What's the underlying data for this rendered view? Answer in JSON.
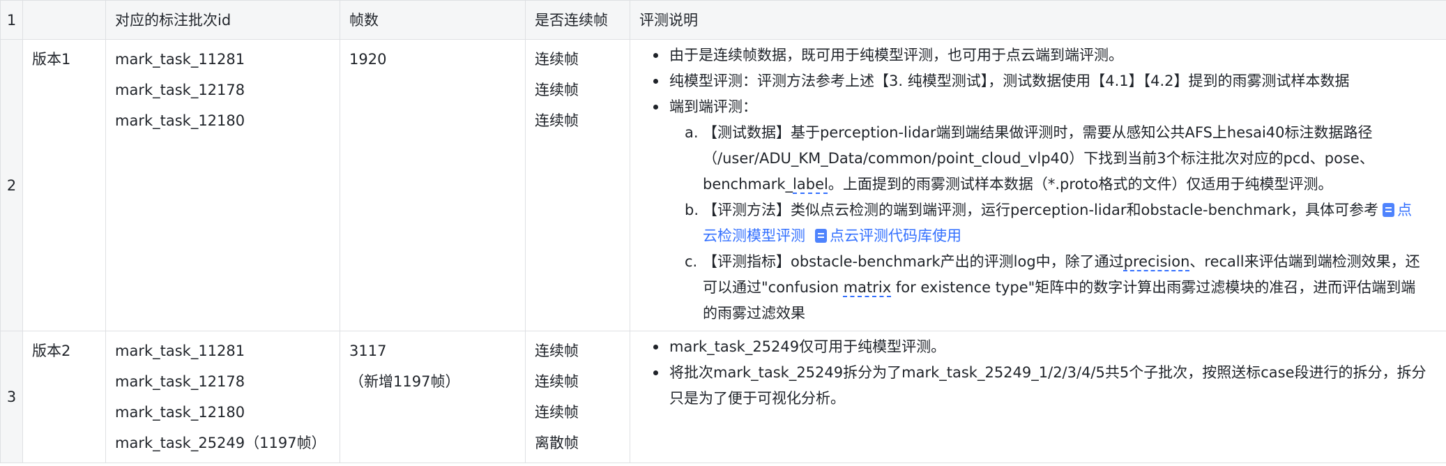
{
  "header": {
    "row_number": "1",
    "col_id": "对应的标注批次id",
    "col_frames": "帧数",
    "col_continuous": "是否连续帧",
    "col_desc": "评测说明"
  },
  "rows": [
    {
      "row_number": "2",
      "version": "版本1",
      "ids": [
        "mark_task_11281",
        "mark_task_12178",
        "mark_task_12180"
      ],
      "frames": [
        "1920"
      ],
      "continuous": [
        "连续帧",
        "连续帧",
        "连续帧"
      ],
      "desc": {
        "bullet1": "由于是连续帧数据，既可用于纯模型评测，也可用于点云端到端评测。",
        "bullet2": "纯模型评测：评测方法参考上述【3. 纯模型测试】，测试数据使用【4.1】【4.2】提到的雨雾测试样本数据",
        "bullet3": "端到端评测：",
        "sub_a": {
          "mark": "a.",
          "line1": "【测试数据】基于perception-lidar端到端结果做评测时，需要从感知公共AFS上hesai40标注数据路径",
          "line2": "（/user/ADU_KM_Data/common/point_cloud_vlp40）下找到当前3个标注批次对应的pcd、pose、",
          "line3_pre": "benchmark_",
          "line3_mid": "label",
          "line3_post": "。上面提到的雨雾测试样本数据（*.proto格式的文件）仅适用于纯模型评测。"
        },
        "sub_b": {
          "mark": "b.",
          "line1": "【评测方法】类似点云检测的端到端评测，运行perception-lidar和obstacle-benchmark，具体可参考",
          "link1_a": "点",
          "link1_b": "云检测模型评测",
          "link2": "点云评测代码库使用"
        },
        "sub_c": {
          "mark": "c.",
          "line1_pre": "【评测指标】obstacle-benchmark产出的评测log中，除了通过",
          "line1_mid": "precision",
          "line1_post": "、recall来评估端到端检测效果，还",
          "line2_pre": "可以通过\"confusion ",
          "line2_mid": "matrix",
          "line2_post": " for existence type\"矩阵中的数字计算出雨雾过滤模块的准召，进而评估端到端",
          "line3": "的雨雾过滤效果"
        }
      }
    },
    {
      "row_number": "3",
      "version": "版本2",
      "ids": [
        "mark_task_11281",
        "mark_task_12178",
        "mark_task_12180",
        "mark_task_25249（1197帧）"
      ],
      "frames": [
        "3117",
        "（新增1197帧）"
      ],
      "continuous": [
        "连续帧",
        "连续帧",
        "连续帧",
        "离散帧"
      ],
      "desc": {
        "bullet1": "mark_task_25249仅可用于纯模型评测。",
        "bullet2_line1": "将批次mark_task_25249拆分为了mark_task_25249_1/2/3/4/5共5个子批次，按照送标case段进行的拆分，拆分",
        "bullet2_line2": "只是为了便于可视化分析。"
      }
    }
  ]
}
